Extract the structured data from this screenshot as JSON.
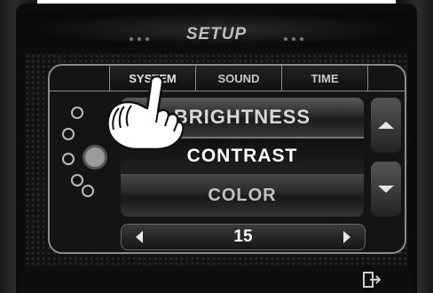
{
  "header": {
    "title": "SETUP"
  },
  "tabs": [
    {
      "label": "SYSTEM",
      "active": true
    },
    {
      "label": "SOUND",
      "active": false
    },
    {
      "label": "TIME",
      "active": false
    }
  ],
  "menu": {
    "items": [
      "BRIGHTNESS",
      "CONTRAST",
      "COLOR"
    ],
    "selected": "CONTRAST"
  },
  "stepper": {
    "value": "15"
  },
  "icons": {
    "scroll_up": "triangle-up-icon",
    "scroll_down": "triangle-down-icon",
    "decrease": "triangle-left-icon",
    "increase": "triangle-right-icon",
    "exit": "exit-icon",
    "hand": "pointing-hand-icon"
  }
}
